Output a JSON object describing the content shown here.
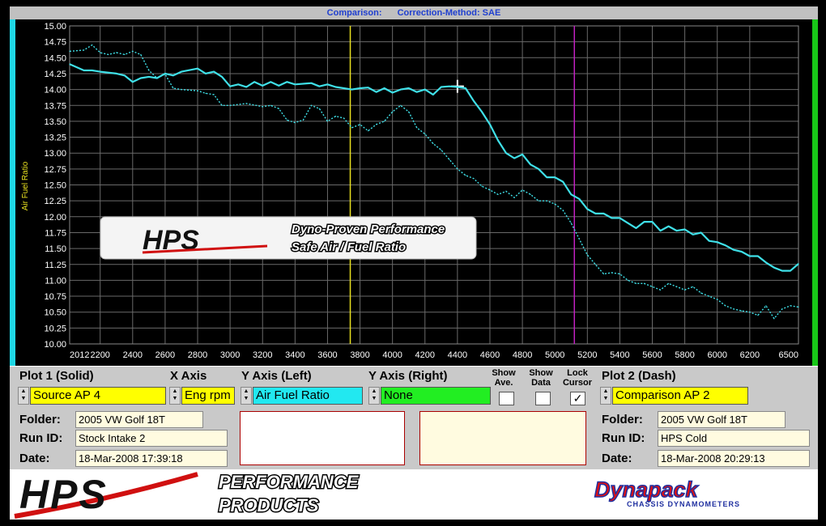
{
  "window": {
    "title_left": "Comparison:",
    "title_right": "Correction-Method: SAE"
  },
  "colors": {
    "plot_background": "#000000",
    "grid": "#6a6a6a",
    "solid_trace": "#3fe0e8",
    "dash_trace": "#3fe0e8",
    "cursor_1": "#e8e020",
    "cursor_2": "#c020c0",
    "left_edge": "#1fd8e6",
    "right_edge": "#18c818"
  },
  "chart_data": {
    "type": "line",
    "ylabel": "Air Fuel Ratio",
    "xlabel": "",
    "xlim": [
      2012,
      6500
    ],
    "ylim": [
      10.0,
      15.0
    ],
    "x_ticks": [
      "2012",
      "2200",
      "2400",
      "2600",
      "2800",
      "3000",
      "3200",
      "3400",
      "3600",
      "3800",
      "4000",
      "4200",
      "4400",
      "4600",
      "4800",
      "5000",
      "5200",
      "5400",
      "5600",
      "5800",
      "6000",
      "6200",
      "6500"
    ],
    "x_tick_values": [
      2012,
      2200,
      2400,
      2600,
      2800,
      3000,
      3200,
      3400,
      3600,
      3800,
      4000,
      4200,
      4400,
      4600,
      4800,
      5000,
      5200,
      5400,
      5600,
      5800,
      6000,
      6200,
      6500
    ],
    "y_ticks": [
      "15.00",
      "14.75",
      "14.50",
      "14.25",
      "14.00",
      "13.75",
      "13.50",
      "13.25",
      "13.00",
      "12.75",
      "12.50",
      "12.25",
      "12.00",
      "11.75",
      "11.50",
      "11.25",
      "11.00",
      "10.75",
      "10.50",
      "10.25",
      "10.00"
    ],
    "y_tick_values": [
      15.0,
      14.75,
      14.5,
      14.25,
      14.0,
      13.75,
      13.5,
      13.25,
      13.0,
      12.75,
      12.5,
      12.25,
      12.0,
      11.75,
      11.5,
      11.25,
      11.0,
      10.75,
      10.5,
      10.25,
      10.0
    ],
    "grid": true,
    "cursor_lines_rpm": [
      3740,
      5120
    ],
    "crosshair": {
      "x": 4400,
      "y": 14.05
    },
    "series": [
      {
        "style": "solid",
        "x": [
          2012,
          2100,
          2150,
          2200,
          2300,
          2350,
          2400,
          2450,
          2500,
          2550,
          2600,
          2650,
          2700,
          2800,
          2850,
          2900,
          2950,
          3000,
          3050,
          3100,
          3150,
          3200,
          3250,
          3300,
          3350,
          3400,
          3500,
          3550,
          3600,
          3650,
          3700,
          3750,
          3800,
          3850,
          3900,
          3950,
          4000,
          4050,
          4100,
          4150,
          4200,
          4250,
          4300,
          4350,
          4400,
          4450,
          4500,
          4550,
          4600,
          4650,
          4700,
          4750,
          4800,
          4850,
          4900,
          4950,
          5000,
          5050,
          5100,
          5150,
          5200,
          5250,
          5300,
          5350,
          5400,
          5450,
          5500,
          5550,
          5600,
          5650,
          5700,
          5750,
          5800,
          5850,
          5900,
          5950,
          6000,
          6050,
          6100,
          6150,
          6200,
          6250,
          6300,
          6350,
          6400,
          6450,
          6500
        ],
        "y": [
          14.4,
          14.3,
          14.3,
          14.28,
          14.25,
          14.22,
          14.12,
          14.18,
          14.2,
          14.18,
          14.25,
          14.22,
          14.28,
          14.33,
          14.25,
          14.28,
          14.2,
          14.05,
          14.08,
          14.04,
          14.12,
          14.06,
          14.12,
          14.06,
          14.12,
          14.08,
          14.1,
          14.05,
          14.08,
          14.04,
          14.02,
          14.0,
          14.02,
          14.03,
          13.96,
          14.02,
          13.95,
          14.0,
          14.02,
          13.96,
          14.0,
          13.92,
          14.04,
          14.05,
          14.04,
          14.02,
          13.82,
          13.65,
          13.45,
          13.2,
          13.0,
          12.92,
          12.98,
          12.82,
          12.75,
          12.62,
          12.62,
          12.55,
          12.35,
          12.28,
          12.12,
          12.05,
          12.05,
          11.98,
          11.98,
          11.9,
          11.82,
          11.92,
          11.92,
          11.78,
          11.85,
          11.78,
          11.8,
          11.72,
          11.75,
          11.62,
          11.6,
          11.55,
          11.48,
          11.45,
          11.38,
          11.38,
          11.28,
          11.2,
          11.15,
          11.15,
          11.26
        ]
      },
      {
        "style": "dash",
        "x": [
          2012,
          2100,
          2150,
          2200,
          2250,
          2300,
          2350,
          2400,
          2450,
          2500,
          2550,
          2600,
          2650,
          2700,
          2800,
          2850,
          2900,
          2950,
          3000,
          3100,
          3200,
          3250,
          3300,
          3350,
          3400,
          3450,
          3500,
          3550,
          3600,
          3650,
          3700,
          3750,
          3800,
          3850,
          3900,
          3950,
          4000,
          4050,
          4100,
          4150,
          4200,
          4250,
          4300,
          4350,
          4400,
          4450,
          4500,
          4550,
          4600,
          4650,
          4700,
          4750,
          4800,
          4850,
          4900,
          4950,
          5000,
          5050,
          5100,
          5150,
          5200,
          5250,
          5300,
          5350,
          5400,
          5450,
          5500,
          5550,
          5600,
          5650,
          5700,
          5750,
          5800,
          5850,
          5900,
          5950,
          6000,
          6050,
          6100,
          6150,
          6200,
          6250,
          6300,
          6350,
          6400,
          6450,
          6500
        ],
        "y": [
          14.6,
          14.62,
          14.7,
          14.58,
          14.55,
          14.58,
          14.55,
          14.6,
          14.55,
          14.3,
          14.18,
          14.24,
          14.02,
          14.0,
          13.98,
          13.94,
          13.92,
          13.75,
          13.75,
          13.78,
          13.73,
          13.75,
          13.7,
          13.52,
          13.48,
          13.52,
          13.75,
          13.7,
          13.5,
          13.58,
          13.55,
          13.4,
          13.45,
          13.35,
          13.45,
          13.5,
          13.65,
          13.75,
          13.65,
          13.4,
          13.3,
          13.15,
          13.05,
          12.9,
          12.75,
          12.65,
          12.6,
          12.48,
          12.42,
          12.35,
          12.4,
          12.3,
          12.42,
          12.35,
          12.25,
          12.25,
          12.2,
          12.1,
          11.9,
          11.65,
          11.4,
          11.25,
          11.1,
          11.12,
          11.1,
          11.0,
          10.95,
          10.95,
          10.9,
          10.85,
          10.95,
          10.9,
          10.85,
          10.9,
          10.8,
          10.75,
          10.7,
          10.6,
          10.55,
          10.52,
          10.5,
          10.45,
          10.6,
          10.4,
          10.55,
          10.6,
          10.58
        ]
      }
    ]
  },
  "overlay_banner": {
    "logo": "HPS",
    "line1": "Dyno-Proven Performance",
    "line2": "Safe Air / Fuel Ratio"
  },
  "controls": {
    "plot1_label": "Plot 1 (Solid)",
    "xaxis_label": "X Axis",
    "yaxis_left_label": "Y Axis (Left)",
    "yaxis_right_label": "Y Axis (Right)",
    "show_ave_label": "Show Ave.",
    "show_data_label": "Show Data",
    "lock_cursor_label": "Lock Cursor",
    "plot2_label": "Plot 2 (Dash)",
    "plot1_value": "Source AP 4",
    "xaxis_value": "Eng rpm",
    "yaxis_left_value": "Air Fuel Ratio",
    "yaxis_right_value": "None",
    "plot2_value": "Comparison AP 2",
    "show_ave_checked": false,
    "show_data_checked": false,
    "lock_cursor_checked": true,
    "lock_cursor_mark": "✓",
    "plot1_color": "#ffff00",
    "xaxis_color": "#ffff00",
    "yaxis_left_color": "#22e8f0",
    "yaxis_right_color": "#22ee22",
    "plot2_color": "#ffff00"
  },
  "run1": {
    "folder_label": "Folder:",
    "folder": "2005 VW Golf 18T",
    "runid_label": "Run ID:",
    "runid": "Stock Intake 2",
    "date_label": "Date:",
    "date": "18-Mar-2008  17:39:18"
  },
  "run2": {
    "folder_label": "Folder:",
    "folder": "2005 VW Golf 18T",
    "runid_label": "Run ID:",
    "runid": "HPS Cold",
    "date_label": "Date:",
    "date": "18-Mar-2008  20:29:13"
  },
  "footer": {
    "hps_logo": "HPS",
    "perf_line1": "PERFORMANCE",
    "perf_line2": "PRODUCTS",
    "dynapack_logo": "Dynapack",
    "dynapack_sub": "CHASSIS DYNAMOMETERS"
  }
}
